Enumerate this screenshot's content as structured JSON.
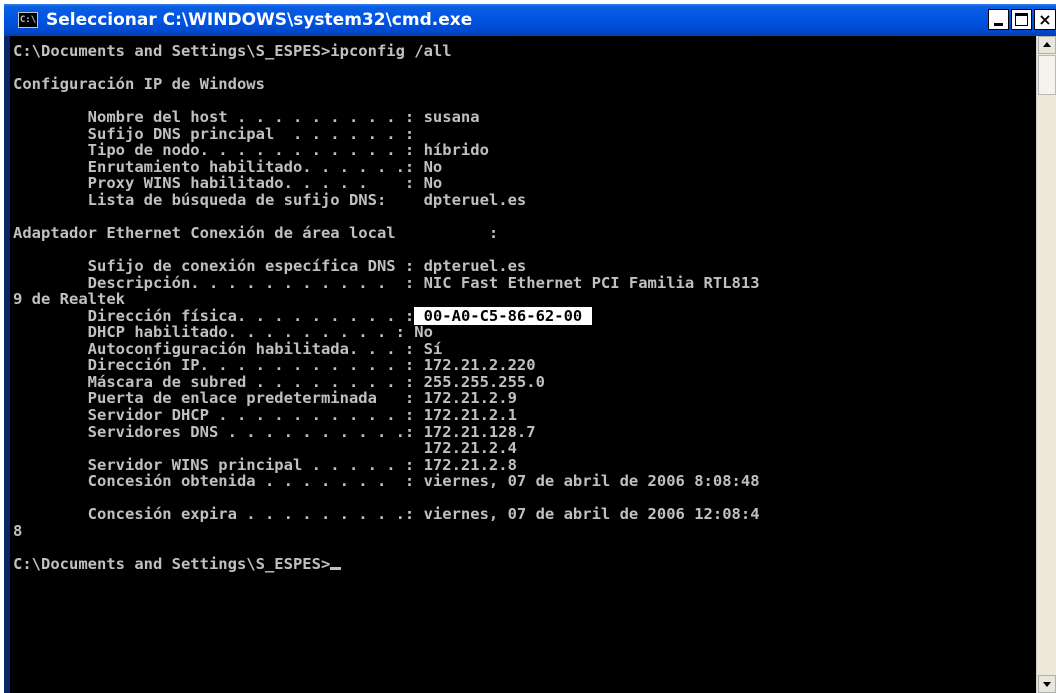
{
  "window": {
    "title": "Seleccionar C:\\WINDOWS\\system32\\cmd.exe",
    "icon_label": "C:\\",
    "close_glyph": "×"
  },
  "console": {
    "lines": [
      "C:\\Documents and Settings\\S_ESPES>ipconfig /all",
      "",
      "Configuración IP de Windows",
      "",
      "        Nombre del host . . . . . . . . . : susana",
      "        Sufijo DNS principal  . . . . . . :",
      "        Tipo de nodo. . . . . . . . . . . : híbrido",
      "        Enrutamiento habilitado. . . . . .: No",
      "        Proxy WINS habilitado. . . . .    : No",
      "        Lista de búsqueda de sufijo DNS:    dpteruel.es",
      "",
      "Adaptador Ethernet Conexión de área local          :",
      "",
      "        Sufijo de conexión específica DNS : dpteruel.es",
      "        Descripción. . . . . . . . . . .  : NIC Fast Ethernet PCI Familia RTL813",
      "9 de Realtek",
      "        Dirección física. . . . . . . . . : 00-A0-C5-86-62-00",
      "        DHCP habilitado. . . . . . . . . : No",
      "        Autoconfiguración habilitada. . . : Sí",
      "        Dirección IP. . . . . . . . . . . : 172.21.2.220",
      "        Máscara de subred . . . . . . . . : 255.255.255.0",
      "        Puerta de enlace predeterminada   : 172.21.2.9",
      "        Servidor DHCP . . . . . . . . . . : 172.21.2.1",
      "        Servidores DNS . . . . . . . . . .: 172.21.128.7",
      "                                            172.21.2.4",
      "        Servidor WINS principal . . . . . : 172.21.2.8",
      "        Concesión obtenida . . . . . . .  : viernes, 07 de abril de 2006 8:08:48",
      "",
      "        Concesión expira . . . . . . . . .: viernes, 07 de abril de 2006 12:08:4",
      "8",
      "",
      "C:\\Documents and Settings\\S_ESPES>"
    ],
    "highlight_prefix": "        Dirección física. . . . . . . . . :",
    "highlight_value": " 00-A0-C5-86-62-00 "
  },
  "colors": {
    "titlebar": "#0054e3",
    "console_bg": "#000000",
    "console_fg": "#c0c0c0",
    "selection_bg": "#ffffff",
    "selection_fg": "#000000"
  },
  "icons": {
    "app": "console-icon",
    "minimize": "minimize-icon",
    "maximize": "maximize-icon",
    "close": "close-icon"
  }
}
